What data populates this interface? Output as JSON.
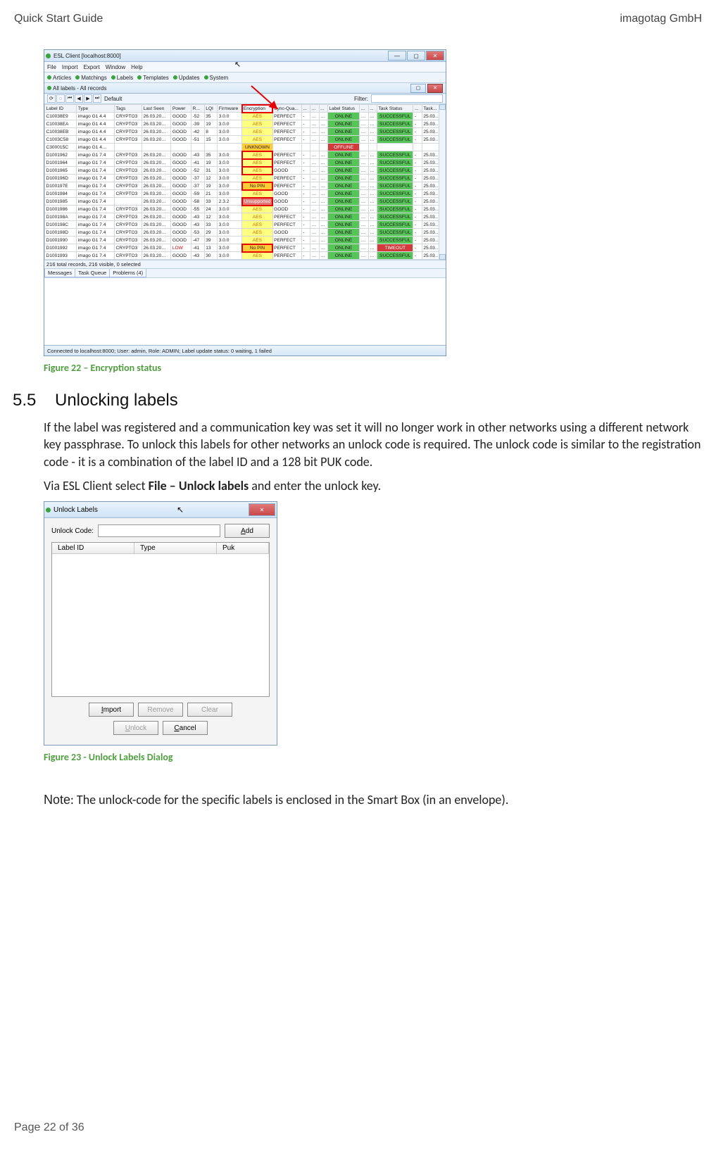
{
  "header": {
    "left": "Quick Start Guide",
    "right": "imagotag GmbH"
  },
  "footer": "Page 22 of 36",
  "fig22_caption": "Figure 22 – Encryption status",
  "fig23_caption": "Figure 23 - Unlock Labels Dialog",
  "section": {
    "num": "5.5",
    "title": "Unlocking labels"
  },
  "para1": "If the label was registered and a communication key was set it will no longer work in other networks using a different network key passphrase. To unlock this labels for other networks an unlock code is required. The unlock code is similar to the registration code - it is a combination of the label ID and a 128 bit PUK code.",
  "para2_a": "Via ESL Client select ",
  "para2_b": "File – Unlock labels",
  "para2_c": " and enter the unlock key.",
  "note_a": "Note",
  "note_b": ": The unlock-code for the specific labels is enclosed in the Smart Box (in an envelope).",
  "win": {
    "title": "ESL Client [localhost:8000]",
    "menus": [
      "File",
      "Import",
      "Export",
      "Window",
      "Help"
    ],
    "toolbar": [
      "Articles",
      "Matchings",
      "Labels",
      "Templates",
      "Updates",
      "System"
    ],
    "subbar_title": "All labels - All records",
    "filter_label": "Filter:",
    "default_label": "Default",
    "columns": [
      "Label ID",
      "Type",
      "Tags",
      "Last Seen",
      "Power",
      "R...",
      "LQI",
      "Firmware",
      "Encryption",
      "Sync-Qua...",
      "...",
      "...",
      "...",
      "Label Status",
      "...",
      "...",
      "Task Status",
      "...",
      "Task..."
    ],
    "rows": [
      {
        "id": "C10038E9",
        "type": "imago G1 4.4",
        "tags": "CRYPTO3",
        "ls": "26.03.20…",
        "pw": "GOOD",
        "r": "-52",
        "lqi": "35",
        "fw": "3.0.0",
        "enc": "AES",
        "sq": "PERFECT",
        "d1": "-",
        "d2": "…",
        "d3": "…",
        "lab": "ONLINE",
        "e1": "…",
        "e2": "…",
        "ts": "SUCCESSFUL",
        "e3": "-",
        "tk": "25.03…"
      },
      {
        "id": "C10038EA",
        "type": "imago G1 4.4",
        "tags": "CRYPTO3",
        "ls": "26.03.20…",
        "pw": "GOOD",
        "r": "-39",
        "lqi": "19",
        "fw": "3.0.0",
        "enc": "AES",
        "sq": "PERFECT",
        "d1": "-",
        "d2": "…",
        "d3": "…",
        "lab": "ONLINE",
        "e1": "…",
        "e2": "…",
        "ts": "SUCCESSFUL",
        "e3": "-",
        "tk": "25.03…"
      },
      {
        "id": "C10038EB",
        "type": "imago G1 4.4",
        "tags": "CRYPTO3",
        "ls": "26.03.20…",
        "pw": "GOOD",
        "r": "-42",
        "lqi": "8",
        "fw": "3.0.0",
        "enc": "AES",
        "sq": "PERFECT",
        "d1": "-",
        "d2": "…",
        "d3": "…",
        "lab": "ONLINE",
        "e1": "…",
        "e2": "…",
        "ts": "SUCCESSFUL",
        "e3": "-",
        "tk": "25.03…"
      },
      {
        "id": "C1003C58",
        "type": "imago G1 4.4",
        "tags": "CRYPTO3",
        "ls": "26.03.20…",
        "pw": "GOOD",
        "r": "-51",
        "lqi": "15",
        "fw": "3.0.0",
        "enc": "AES",
        "sq": "PERFECT",
        "d1": "-",
        "d2": "…",
        "d3": "…",
        "lab": "ONLINE",
        "e1": "…",
        "e2": "…",
        "ts": "SUCCESSFUL",
        "e3": "-",
        "tk": "25.03…"
      },
      {
        "id": "C300015C",
        "type": "imago G1 4…",
        "tags": "",
        "ls": "",
        "pw": "",
        "r": "",
        "lqi": "",
        "fw": "",
        "enc": "UNKNOWN",
        "sq": "",
        "d1": "",
        "d2": "",
        "d3": "",
        "lab": "OFFLINE",
        "e1": "",
        "e2": "",
        "ts": "",
        "e3": "",
        "tk": ""
      },
      {
        "id": "D1001962",
        "type": "imago G1 7.4",
        "tags": "CRYPTO3",
        "ls": "26.03.20…",
        "pw": "GOOD",
        "r": "-43",
        "lqi": "35",
        "fw": "3.0.0",
        "enc": "AES",
        "sq": "PERFECT",
        "d1": "-",
        "d2": "…",
        "d3": "…",
        "lab": "ONLINE",
        "e1": "…",
        "e2": "…",
        "ts": "SUCCESSFUL",
        "e3": "-",
        "tk": "25.03…"
      },
      {
        "id": "D1001964",
        "type": "imago G1 7.4",
        "tags": "CRYPTO3",
        "ls": "26.03.20…",
        "pw": "GOOD",
        "r": "-41",
        "lqi": "19",
        "fw": "3.0.0",
        "enc": "AES",
        "sq": "PERFECT",
        "d1": "-",
        "d2": "…",
        "d3": "…",
        "lab": "ONLINE",
        "e1": "…",
        "e2": "…",
        "ts": "SUCCESSFUL",
        "e3": "-",
        "tk": "25.03…"
      },
      {
        "id": "D1001965",
        "type": "imago G1 7.4",
        "tags": "CRYPTO3",
        "ls": "26.03.20…",
        "pw": "GOOD",
        "r": "-52",
        "lqi": "31",
        "fw": "3.0.0",
        "enc": "AES",
        "sq": "GOOD",
        "d1": "-",
        "d2": "…",
        "d3": "…",
        "lab": "ONLINE",
        "e1": "…",
        "e2": "…",
        "ts": "SUCCESSFUL",
        "e3": "-",
        "tk": "25.03…"
      },
      {
        "id": "D100196D",
        "type": "imago G1 7.4",
        "tags": "CRYPTO3",
        "ls": "26.03.20…",
        "pw": "GOOD",
        "r": "-37",
        "lqi": "12",
        "fw": "3.0.0",
        "enc": "AES",
        "sq": "PERFECT",
        "d1": "-",
        "d2": "…",
        "d3": "…",
        "lab": "ONLINE",
        "e1": "…",
        "e2": "…",
        "ts": "SUCCESSFUL",
        "e3": "-",
        "tk": "25.03…"
      },
      {
        "id": "D100197E",
        "type": "imago G1 7.4",
        "tags": "CRYPTO3",
        "ls": "26.03.20…",
        "pw": "GOOD",
        "r": "-37",
        "lqi": "19",
        "fw": "3.0.0",
        "enc": "No PIN",
        "sq": "PERFECT",
        "d1": "-",
        "d2": "…",
        "d3": "…",
        "lab": "ONLINE",
        "e1": "…",
        "e2": "…",
        "ts": "SUCCESSFUL",
        "e3": "-",
        "tk": "25.03…"
      },
      {
        "id": "D1001984",
        "type": "imago G1 7.4",
        "tags": "CRYPTO3",
        "ls": "26.03.20…",
        "pw": "GOOD",
        "r": "-59",
        "lqi": "21",
        "fw": "3.0.0",
        "enc": "AES",
        "sq": "GOOD",
        "d1": "-",
        "d2": "…",
        "d3": "…",
        "lab": "ONLINE",
        "e1": "…",
        "e2": "…",
        "ts": "SUCCESSFUL",
        "e3": "-",
        "tk": "25.03…"
      },
      {
        "id": "D1001985",
        "type": "imago G1 7.4",
        "tags": "",
        "ls": "26.03.20…",
        "pw": "GOOD",
        "r": "-58",
        "lqi": "33",
        "fw": "2.3.2",
        "enc": "Unsupported",
        "sq": "GOOD",
        "d1": "-",
        "d2": "…",
        "d3": "…",
        "lab": "ONLINE",
        "e1": "…",
        "e2": "…",
        "ts": "SUCCESSFUL",
        "e3": "-",
        "tk": "25.03…"
      },
      {
        "id": "D1001986",
        "type": "imago G1 7.4",
        "tags": "CRYPTO3",
        "ls": "26.03.20…",
        "pw": "GOOD",
        "r": "-55",
        "lqi": "24",
        "fw": "3.0.0",
        "enc": "AES",
        "sq": "GOOD",
        "d1": "-",
        "d2": "…",
        "d3": "…",
        "lab": "ONLINE",
        "e1": "…",
        "e2": "…",
        "ts": "SUCCESSFUL",
        "e3": "-",
        "tk": "25.03…"
      },
      {
        "id": "D100198A",
        "type": "imago G1 7.4",
        "tags": "CRYPTO3",
        "ls": "26.03.20…",
        "pw": "GOOD",
        "r": "-43",
        "lqi": "12",
        "fw": "3.0.0",
        "enc": "AES",
        "sq": "PERFECT",
        "d1": "-",
        "d2": "…",
        "d3": "…",
        "lab": "ONLINE",
        "e1": "…",
        "e2": "…",
        "ts": "SUCCESSFUL",
        "e3": "-",
        "tk": "25.03…"
      },
      {
        "id": "D100198C",
        "type": "imago G1 7.4",
        "tags": "CRYPTO3",
        "ls": "26.03.20…",
        "pw": "GOOD",
        "r": "-43",
        "lqi": "33",
        "fw": "3.0.0",
        "enc": "AES",
        "sq": "PERFECT",
        "d1": "-",
        "d2": "…",
        "d3": "…",
        "lab": "ONLINE",
        "e1": "…",
        "e2": "…",
        "ts": "SUCCESSFUL",
        "e3": "-",
        "tk": "25.03…"
      },
      {
        "id": "D100198D",
        "type": "imago G1 7.4",
        "tags": "CRYPTO3",
        "ls": "26.03.20…",
        "pw": "GOOD",
        "r": "-53",
        "lqi": "29",
        "fw": "3.0.0",
        "enc": "AES",
        "sq": "GOOD",
        "d1": "-",
        "d2": "…",
        "d3": "…",
        "lab": "ONLINE",
        "e1": "…",
        "e2": "…",
        "ts": "SUCCESSFUL",
        "e3": "-",
        "tk": "25.03…"
      },
      {
        "id": "D1001990",
        "type": "imago G1 7.4",
        "tags": "CRYPTO3",
        "ls": "26.03.20…",
        "pw": "GOOD",
        "r": "-47",
        "lqi": "39",
        "fw": "3.0.0",
        "enc": "AES",
        "sq": "PERFECT",
        "d1": "-",
        "d2": "…",
        "d3": "…",
        "lab": "ONLINE",
        "e1": "…",
        "e2": "…",
        "ts": "SUCCESSFUL",
        "e3": "-",
        "tk": "25.03…"
      },
      {
        "id": "D1001992",
        "type": "imago G1 7.4",
        "tags": "CRYPTO3",
        "ls": "26.03.20…",
        "pw": "LOW",
        "r": "-41",
        "lqi": "13",
        "fw": "3.0.0",
        "enc": "No PIN",
        "sq": "PERFECT",
        "d1": "-",
        "d2": "…",
        "d3": "…",
        "lab": "ONLINE",
        "e1": "…",
        "e2": "…",
        "ts": "TIMEOUT",
        "e3": "-",
        "tk": "25.03…"
      },
      {
        "id": "D1001993",
        "type": "imago G1 7.4",
        "tags": "CRYPTO3",
        "ls": "26.03.20…",
        "pw": "GOOD",
        "r": "-43",
        "lqi": "30",
        "fw": "3.0.0",
        "enc": "AES",
        "sq": "PERFECT",
        "d1": "-",
        "d2": "…",
        "d3": "…",
        "lab": "ONLINE",
        "e1": "…",
        "e2": "…",
        "ts": "SUCCESSFUL",
        "e3": "-",
        "tk": "25.03…"
      }
    ],
    "status1": "216 total records, 216 visible, 0 selected",
    "tabs": [
      "Messages",
      "Task Queue",
      "Problems (4)"
    ],
    "statusfoot": "Connected to localhost:8000; User: admin, Role: ADMIN; Label update status: 0 waiting, 1 failed"
  },
  "dlg": {
    "title": "Unlock Labels",
    "code_label": "Unlock Code:",
    "add_btn": "Add",
    "cols": [
      "Label ID",
      "Type",
      "Puk"
    ],
    "import_btn": "Import",
    "remove_btn": "Remove",
    "clear_btn": "Clear",
    "unlock_btn": "Unlock",
    "cancel_btn": "Cancel"
  }
}
